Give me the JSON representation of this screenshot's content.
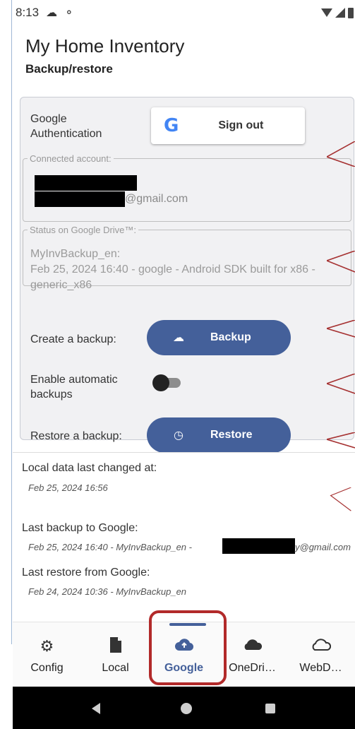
{
  "status_bar": {
    "time": "8:13",
    "icons": [
      "cloud-icon",
      "sync-icon",
      "wifi-icon",
      "signal-icon",
      "battery-icon"
    ]
  },
  "app": {
    "title": "My Home Inventory",
    "subtitle": "Backup/restore"
  },
  "auth": {
    "label": "Google Authentication",
    "sign_out_label": "Sign out"
  },
  "account": {
    "legend": "Connected account:",
    "email_suffix": "@gmail.com"
  },
  "drive_status": {
    "legend": "Status on Google Drive™:",
    "text": "MyInvBackup_en:\nFeb 25, 2024 16:40 - google - Android SDK built for x86 - generic_x86"
  },
  "backup": {
    "label": "Create a backup:",
    "button_label": "Backup"
  },
  "auto_backup": {
    "label": "Enable automatic backups",
    "enabled": false
  },
  "restore": {
    "label": "Restore a backup:",
    "button_label": "Restore"
  },
  "info": {
    "local_changed_label": "Local data last changed at:",
    "local_changed_value": "Feb 25, 2024 16:56",
    "last_backup_label": "Last backup to Google:",
    "last_backup_value": "Feb 25, 2024 16:40 - MyInvBackup_en -",
    "last_backup_email_suffix": "y@gmail.com",
    "last_restore_label": "Last restore from Google:",
    "last_restore_value": "Feb 24, 2024 10:36 - MyInvBackup_en"
  },
  "bottom_nav": [
    {
      "label": "Config",
      "icon": "gear-icon"
    },
    {
      "label": "Local",
      "icon": "file-icon"
    },
    {
      "label": "Google",
      "icon": "cloud-upload-icon",
      "active": true
    },
    {
      "label": "OneDri…",
      "icon": "cloud-filled-icon"
    },
    {
      "label": "WebD…",
      "icon": "cloud-outline-icon"
    }
  ],
  "colors": {
    "primary": "#44609a",
    "highlight": "#b22a2a",
    "callout": "#a63232"
  }
}
